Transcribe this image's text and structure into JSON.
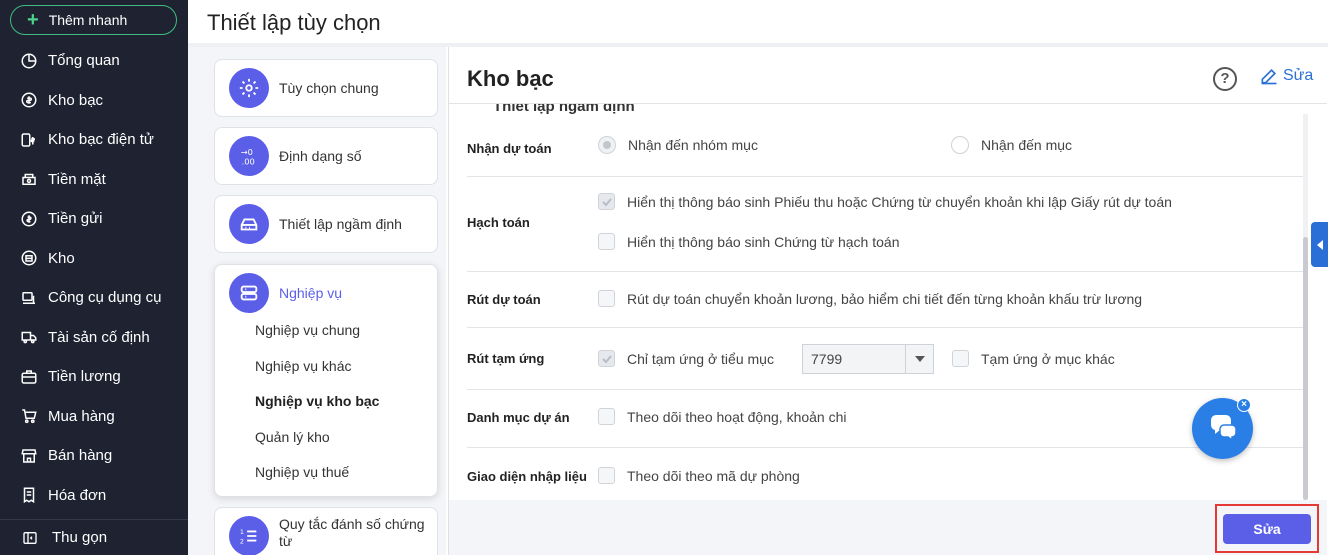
{
  "sidebar": {
    "quick_add": "Thêm nhanh",
    "items": [
      {
        "label": "Tổng quan",
        "icon": "chart-pie-icon"
      },
      {
        "label": "Kho bạc",
        "icon": "money-circle-icon"
      },
      {
        "label": "Kho bạc điện tử",
        "icon": "money-transfer-icon"
      },
      {
        "label": "Tiền mặt",
        "icon": "cash-icon"
      },
      {
        "label": "Tiền gửi",
        "icon": "deposit-icon"
      },
      {
        "label": "Kho",
        "icon": "warehouse-icon"
      },
      {
        "label": "Công cụ dụng cụ",
        "icon": "tools-icon"
      },
      {
        "label": "Tài sản cố định",
        "icon": "truck-icon"
      },
      {
        "label": "Tiền lương",
        "icon": "briefcase-icon"
      },
      {
        "label": "Mua hàng",
        "icon": "cart-icon"
      },
      {
        "label": "Bán hàng",
        "icon": "store-icon"
      },
      {
        "label": "Hóa đơn",
        "icon": "invoice-icon"
      }
    ],
    "collapse": "Thu gọn"
  },
  "page_title": "Thiết lập tùy chọn",
  "menu": {
    "general": "Tùy chọn chung",
    "number_format": "Định dạng số",
    "defaults": "Thiết lập ngầm định",
    "operations": "Nghiệp vụ",
    "operations_sub": [
      "Nghiệp vụ chung",
      "Nghiệp vụ khác",
      "Nghiệp vụ kho bạc",
      "Quản lý kho",
      "Nghiệp vụ thuế"
    ],
    "numbering": "Quy tắc đánh số chứng từ"
  },
  "main": {
    "title": "Kho bạc",
    "edit_label": "Sửa",
    "section_cut": "Thiết lập ngầm định",
    "rows": {
      "estimate": {
        "label": "Nhận dự toán",
        "opt1": "Nhận đến nhóm mục",
        "opt2": "Nhận đến mục"
      },
      "accounting": {
        "label": "Hạch toán",
        "opt1": "Hiển thị thông báo sinh Phiếu thu hoặc Chứng từ chuyển khoản khi lập Giấy rút dự toán",
        "opt2": "Hiển thị thông báo sinh Chứng từ hạch toán"
      },
      "withdraw": {
        "label": "Rút dự toán",
        "opt1": "Rút dự toán chuyển khoản lương, bảo hiểm chi tiết đến từng khoản khấu trừ lương"
      },
      "advance": {
        "label": "Rút tạm ứng",
        "opt1": "Chỉ tạm ứng ở tiểu mục",
        "select_value": "7799",
        "opt2": "Tạm ứng ở mục khác"
      },
      "project": {
        "label": "Danh mục dự án",
        "opt1": "Theo dõi theo hoạt động, khoản chi"
      },
      "input": {
        "label": "Giao diện nhập liệu",
        "opt1": "Theo dõi theo mã dự phòng"
      }
    },
    "save_label": "Sửa"
  },
  "colors": {
    "accent": "#5b5fe8",
    "sidebar_bg": "#1e2231",
    "link": "#2a6fd6",
    "highlight": "#e53935"
  }
}
